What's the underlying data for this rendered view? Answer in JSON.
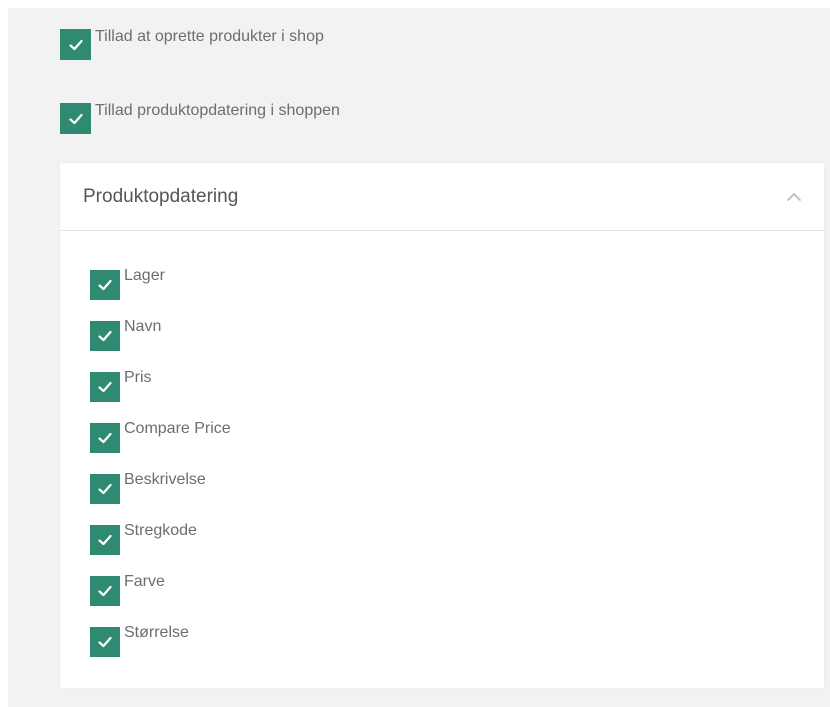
{
  "options": [
    {
      "label": "Tillad at oprette produkter i shop",
      "checked": true
    },
    {
      "label": "Tillad produktopdatering i shoppen",
      "checked": true
    }
  ],
  "panel": {
    "title": "Produktopdatering",
    "collapse_icon": "chevron-up-icon",
    "fields": [
      {
        "label": "Lager",
        "checked": true
      },
      {
        "label": "Navn",
        "checked": true
      },
      {
        "label": "Pris",
        "checked": true
      },
      {
        "label": "Compare Price",
        "checked": true
      },
      {
        "label": "Beskrivelse",
        "checked": true
      },
      {
        "label": "Stregkode",
        "checked": true
      },
      {
        "label": "Farve",
        "checked": true
      },
      {
        "label": "Størrelse",
        "checked": true
      }
    ]
  },
  "colors": {
    "checkbox": "#2e8b72",
    "area_background": "#f2f2f2",
    "label_text": "#6d6d6d"
  }
}
